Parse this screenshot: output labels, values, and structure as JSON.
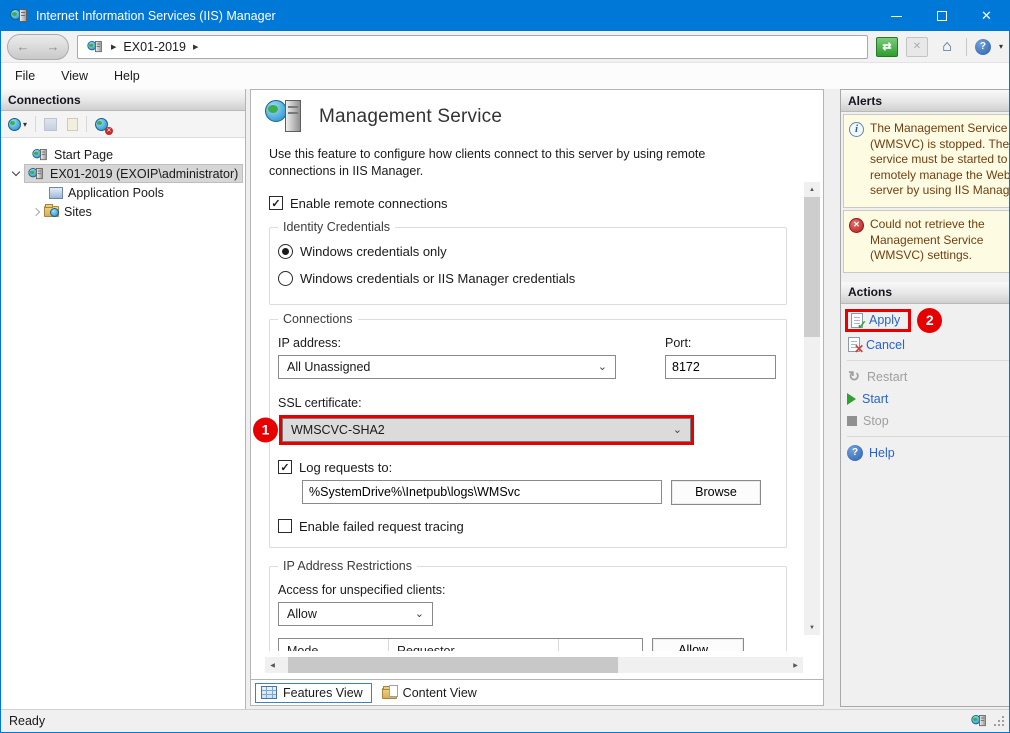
{
  "window": {
    "title": "Internet Information Services (IIS) Manager"
  },
  "icons": {
    "back": "←",
    "forward": "→",
    "crumb": "▶",
    "refresh": "⇄",
    "stop": "✕",
    "home": "⌂",
    "question": "?",
    "caret": "▾",
    "check": "✓",
    "select_caret": "⌄",
    "up": "▲",
    "down": "▼",
    "left": "◀",
    "right": "▶",
    "restart": "↻",
    "info": "i",
    "error": "✕",
    "del": "✕"
  },
  "breadcrumb": {
    "server": "EX01-2019"
  },
  "menu": {
    "items": [
      "File",
      "View",
      "Help"
    ]
  },
  "connections": {
    "header": "Connections",
    "tree": [
      {
        "label": "Start Page"
      },
      {
        "label": "EX01-2019 (EXOIP\\administrator)"
      },
      {
        "label": "Application Pools"
      },
      {
        "label": "Sites"
      }
    ]
  },
  "main": {
    "title": "Management Service",
    "description": "Use this feature to configure how clients connect to this server by using remote connections in IIS Manager.",
    "enable_remote": "Enable remote connections",
    "identity": {
      "legend": "Identity Credentials",
      "windows_only": "Windows credentials only",
      "windows_or_iis": "Windows credentials or IIS Manager credentials"
    },
    "conn": {
      "legend": "Connections",
      "ip_label": "IP address:",
      "ip_value": "All Unassigned",
      "port_label": "Port:",
      "port_value": "8172",
      "ssl_label": "SSL certificate:",
      "ssl_value": "WMSCVC-SHA2",
      "log_label": "Log requests to:",
      "log_path": "%SystemDrive%\\Inetpub\\logs\\WMSvc",
      "browse": "Browse",
      "tracing": "Enable failed request tracing"
    },
    "restrictions": {
      "legend": "IP Address Restrictions",
      "access_label": "Access for unspecified clients:",
      "access_value": "Allow",
      "col_mode": "Mode",
      "col_requestor": "Requestor",
      "allow_btn": "Allow..."
    },
    "tabs": {
      "features": "Features View",
      "content": "Content View"
    }
  },
  "alerts": {
    "header": "Alerts",
    "items": [
      {
        "text": "The Management Service (WMSVC) is stopped. The service must be started to remotely manage the Web server by using IIS Manager."
      },
      {
        "text": "Could not retrieve the Management Service (WMSVC) settings."
      }
    ]
  },
  "actions": {
    "header": "Actions",
    "apply": "Apply",
    "cancel": "Cancel",
    "restart": "Restart",
    "start": "Start",
    "stop": "Stop",
    "help": "Help"
  },
  "badges": {
    "ssl": "1",
    "apply": "2"
  },
  "status": {
    "text": "Ready"
  },
  "colors": {
    "titlebar": "#0078D7",
    "highlight": "#E60000",
    "link": "#2864C8",
    "alert_bg": "#FDFCE3",
    "alert_text": "#713E10"
  }
}
